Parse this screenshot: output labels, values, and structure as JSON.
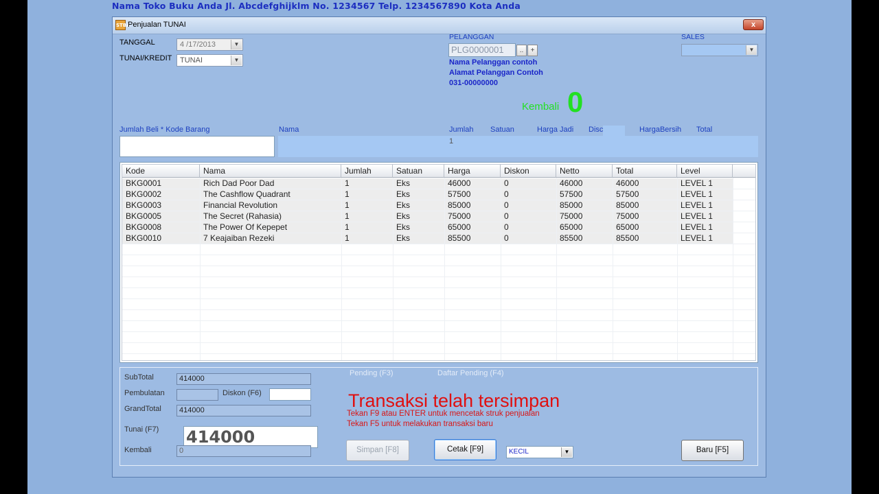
{
  "store_header": "Nama Toko Buku Anda  Jl. Abcdefghijklm No. 1234567  Telp. 1234567890 Kota Anda",
  "window": {
    "title": "Penjualan TUNAI",
    "icon_text": "STBA",
    "close_glyph": "x"
  },
  "form": {
    "tanggal_label": "TANGGAL",
    "tanggal_value": "4 /17/2013",
    "tunai_kredit_label": "TUNAI/KREDIT",
    "tunai_kredit_value": "TUNAI",
    "pelanggan_label": "PELANGGAN",
    "pelanggan_code": "PLG0000001",
    "browse_btn": "..",
    "add_btn": "+",
    "customer_name": "Nama Pelanggan contoh",
    "customer_address": "Alamat Pelanggan Contoh",
    "customer_phone": "031-00000000",
    "sales_label": "SALES",
    "sales_value": "",
    "kembali_label": "Kembali",
    "kembali_value": "0"
  },
  "entry": {
    "qty_code_label": "Jumlah Beli * Kode Barang",
    "nama_label": "Nama",
    "jumlah_label": "Jumlah",
    "satuan_label": "Satuan",
    "harga_jadi_label": "Harga Jadi",
    "disc_label": "Disc",
    "harga_bersih_label": "HargaBersih",
    "total_label": "Total",
    "jumlah_value": "1",
    "input_value": ""
  },
  "table": {
    "columns": [
      "Kode",
      "Nama",
      "Jumlah",
      "Satuan",
      "Harga",
      "Diskon",
      "Netto",
      "Total",
      "Level"
    ],
    "rows": [
      [
        "BKG0001",
        "Rich Dad Poor Dad",
        "1",
        "Eks",
        "46000",
        "0",
        "46000",
        "46000",
        "LEVEL 1"
      ],
      [
        "BKG0002",
        "The Cashflow Quadrant",
        "1",
        "Eks",
        "57500",
        "0",
        "57500",
        "57500",
        "LEVEL 1"
      ],
      [
        "BKG0003",
        "Financial Revolution",
        "1",
        "Eks",
        "85000",
        "0",
        "85000",
        "85000",
        "LEVEL 1"
      ],
      [
        "BKG0005",
        "The Secret (Rahasia)",
        "1",
        "Eks",
        "75000",
        "0",
        "75000",
        "75000",
        "LEVEL 1"
      ],
      [
        "BKG0008",
        "The Power Of Kepepet",
        "1",
        "Eks",
        "65000",
        "0",
        "65000",
        "65000",
        "LEVEL 1"
      ],
      [
        "BKG0010",
        "7 Keajaiban Rezeki",
        "1",
        "Eks",
        "85500",
        "0",
        "85500",
        "85500",
        "LEVEL 1"
      ]
    ]
  },
  "summary": {
    "subtotal_label": "SubTotal",
    "subtotal_value": "414000",
    "pembulatan_label": "Pembulatan",
    "pembulatan_value": "",
    "diskon_label": "Diskon (F6)",
    "diskon_value": "",
    "grandtotal_label": "GrandTotal",
    "grandtotal_value": "414000",
    "tunai_label": "Tunai (F7)",
    "tunai_value": "414000",
    "kembali_label": "Kembali",
    "kembali_value": "0"
  },
  "actions": {
    "pending_link": "Pending (F3)",
    "daftar_pending_link": "Daftar Pending (F4)",
    "status_message": "Transaksi telah tersimpan",
    "hint_1": "Tekan F9 atau ENTER untuk mencetak struk penjualan",
    "hint_2": "Tekan F5 untuk melakukan transaksi baru",
    "simpan_btn": "Simpan [F8]",
    "cetak_btn": "Cetak [F9]",
    "print_size_value": "KECIL",
    "baru_btn": "Baru [F5]"
  },
  "colors": {
    "status_red": "#e01010",
    "kembali_green": "#22e022",
    "info_blue": "#1a25c8"
  }
}
